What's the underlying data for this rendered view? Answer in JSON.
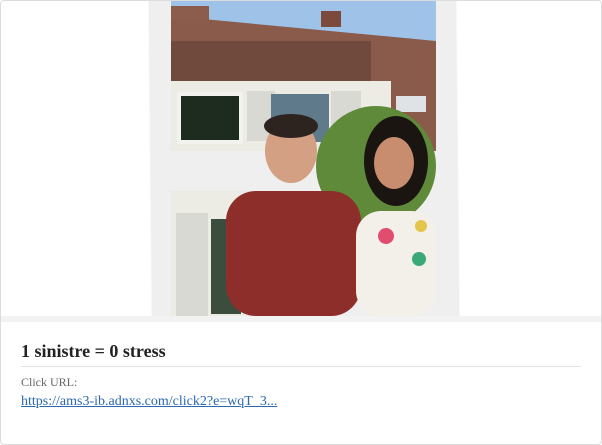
{
  "ad": {
    "image_alt": "couple-in-front-of-house-photo",
    "headline": "1 sinistre = 0 stress",
    "click_url_label": "Click URL:",
    "click_url_text": "https://ams3-ib.adnxs.com/click2?e=wqT_3..."
  },
  "colors": {
    "link": "#2b68b0",
    "headline": "#222222",
    "label": "#666666"
  }
}
